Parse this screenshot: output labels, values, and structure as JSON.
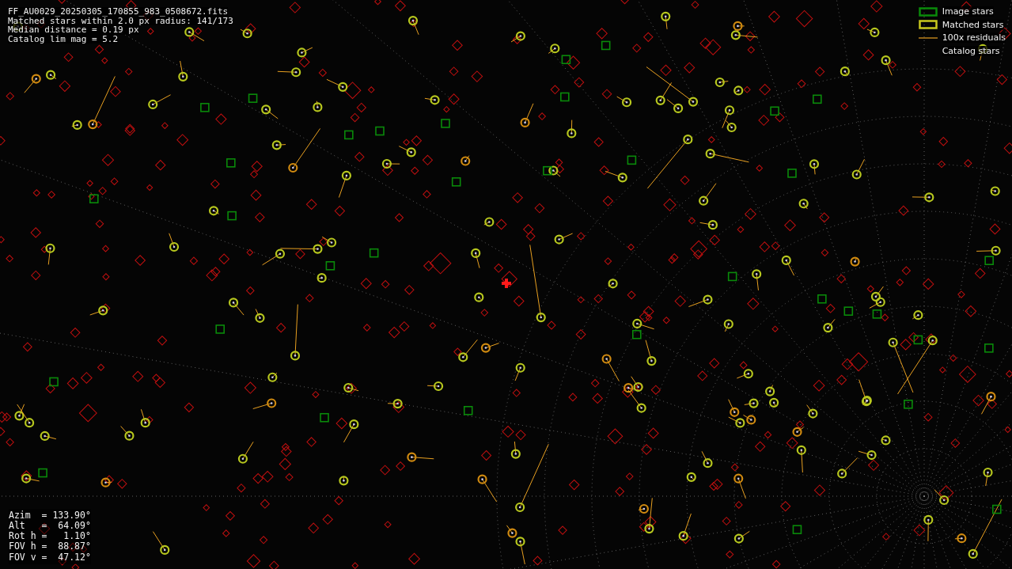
{
  "info": [
    "FF_AU0029_20250305_170855_983_0508672.fits",
    "Matched stars within 2.0 px radius: 141/173",
    "Median distance = 0.19 px",
    "Catalog lim mag = 5.2"
  ],
  "legend": [
    {
      "kind": "image",
      "label": "Image stars"
    },
    {
      "kind": "matched",
      "label": "Matched stars"
    },
    {
      "kind": "residual",
      "label": "100x residuals"
    },
    {
      "kind": "catalog",
      "label": "Catalog stars"
    }
  ],
  "pointing": [
    "Azim  = 133.90°",
    "Alt   =  64.09°",
    "Rot h =   1.10°",
    "FOV h =  88.87°",
    "FOV v =  47.12°"
  ]
}
